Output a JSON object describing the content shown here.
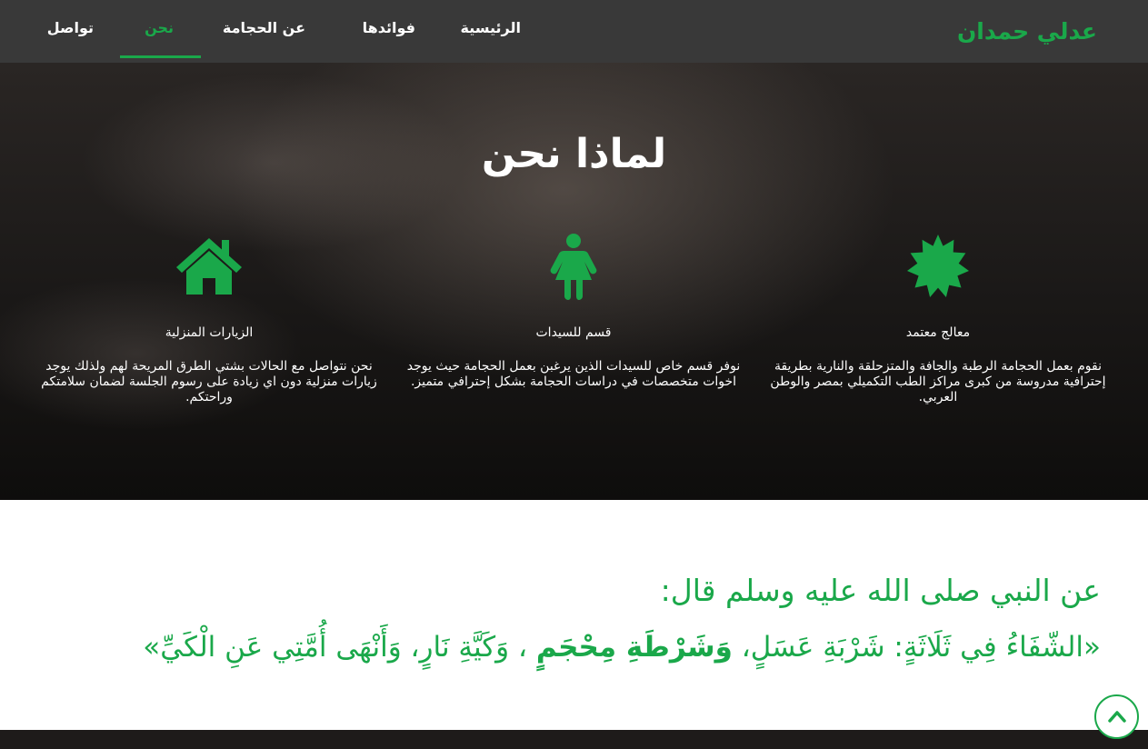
{
  "navbar": {
    "brand": "عدلي حمدان",
    "items": [
      {
        "label": "الرئيسية",
        "active": false
      },
      {
        "label": "فوائدها",
        "active": false
      },
      {
        "label": "عن الحجامة",
        "active": false
      },
      {
        "label": "نحن",
        "active": true
      },
      {
        "label": "تواصل",
        "active": false
      }
    ],
    "accent_color": "#1aa84a"
  },
  "hero": {
    "title": "لماذا نحن",
    "features": [
      {
        "icon": "badge-icon",
        "title": "معالج معتمد",
        "text": "نقوم بعمل الحجامة الرطبة والجافة والمتزحلقة والنارية بطريقة إحترافية مدروسة من كبرى مراكز الطب التكميلي بمصر والوطن العربي."
      },
      {
        "icon": "woman-icon",
        "title": "قسم للسيدات",
        "text": "نوفر قسم خاص للسيدات الذين يرغبن بعمل الحجامة حيث يوجد اخوات متخصصات في دراسات الحجامة بشكل إحترافي متميز."
      },
      {
        "icon": "home-icon",
        "title": "الزيارات المنزلية",
        "text": "نحن نتواصل مع الحالات بشتي الطرق المريحة لهم ولذلك يوجد زيارات منزلية دون اي زيادة على رسوم الجلسة لضمان سلامتكم وراحتكم."
      }
    ]
  },
  "quote": {
    "intro": "عن النبي صلى الله عليه وسلم قال:",
    "part1": "«الشّفَاءُ فِي ثَلَاثَةٍ: شَرْبَةِ عَسَلٍ،",
    "part2": "وَشَرْطَةِ مِحْجَمٍ",
    "part3": "، وَكَيَّةِ نَارٍ، وَأَنْهَى أُمَّتِي عَنِ الْكَيِّ»"
  },
  "back_to_top": {
    "icon": "chevron-up-icon"
  }
}
